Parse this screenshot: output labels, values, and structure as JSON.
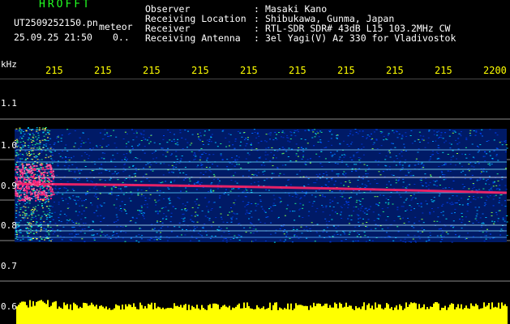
{
  "logo": "HROFFT",
  "file_name": "UT2509252150.pn",
  "mode": "meteor",
  "datetime": "25.09.25 21:50",
  "count": "0..",
  "header": {
    "labels": [
      "Observer",
      "Receiving Location",
      "Receiver",
      "Receiving Antenna"
    ],
    "values": [
      "Masaki Kano",
      "Shibukawa, Gunma, Japan",
      "RTL-SDR SDR# 43dB L15 103.2MHz CW",
      "3el Yagi(V) Az 330 for Vladivostok"
    ]
  },
  "y_axis_unit": "kHz",
  "y_axis_labels": [
    "1.1",
    "1.0",
    "0.9",
    "0.8",
    "0.7",
    "0.6"
  ],
  "time_ticks": [
    "215",
    "215",
    "215",
    "215",
    "215",
    "215",
    "215",
    "215",
    "215",
    "2200"
  ],
  "colors": {
    "text": "#ffffff",
    "time_axis": "#ffff00",
    "logo": "#22ff22",
    "echo_trace": "#ff2266",
    "noise_bar": "#ffff00",
    "band": "#0033aa"
  }
}
